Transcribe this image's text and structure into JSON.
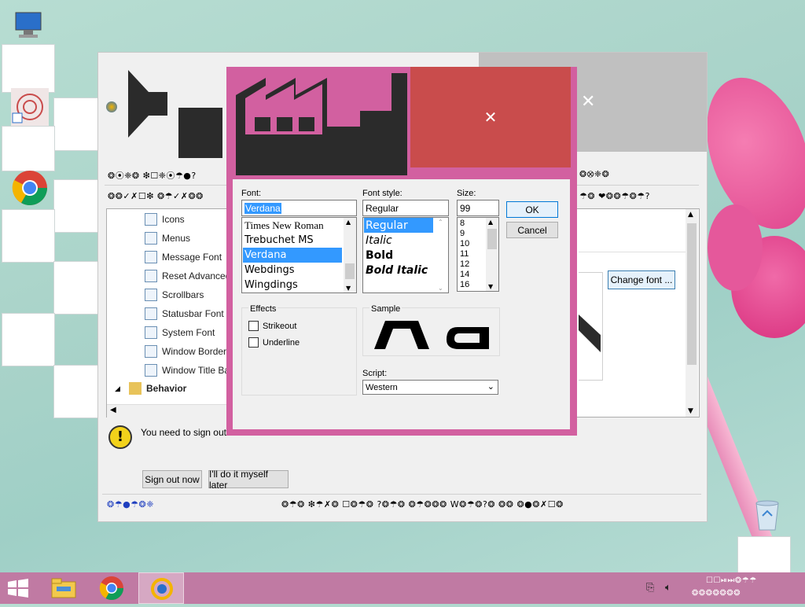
{
  "desktop": {
    "recycle_bin_label": ""
  },
  "bg_window": {
    "toolbar_row1_left": "❂⦿❈❂  ❇☐❈⦿☂●?",
    "toolbar_row1_right": "❂⭙❈❂",
    "toolbar_row2_left": "❂❂✓✗☐❇  ❂☂✓✗❂❂",
    "toolbar_row2_right": "☂❂  ❤❂❂☂❂☂?",
    "tree_items": [
      {
        "label": "Icons",
        "icon": "icons-icon"
      },
      {
        "label": "Menus",
        "icon": "menus-icon"
      },
      {
        "label": "Message Font",
        "icon": "warning-icon"
      },
      {
        "label": "Reset Advanced",
        "icon": "reset-icon"
      },
      {
        "label": "Scrollbars",
        "icon": "scrollbars-icon"
      },
      {
        "label": "Statusbar Font",
        "icon": "font-icon"
      },
      {
        "label": "System Font",
        "icon": "font-a-icon"
      },
      {
        "label": "Window Borders",
        "icon": "window-icon"
      },
      {
        "label": "Window Title Bars",
        "icon": "window-icon"
      }
    ],
    "behavior_label": "Behavior",
    "change_font_label": "Change font ...",
    "notice_text": "You need to sign out ar",
    "sign_out_label": "Sign out now",
    "do_it_later_label": "I'll do it myself later",
    "status_left": "❂☂●☂❂❈",
    "status_right": "❂☂❂  ❇☂✗❂  ☐❂☂❂  ?❂☂❂  ❂☂❂❂❂  W❂☂❂?❂  ❂❂  ❂●❂✗☐❂"
  },
  "font_dialog": {
    "font_label": "Font:",
    "font_value": "Verdana",
    "font_list": [
      "Times New Roman",
      "Trebuchet MS",
      "Verdana",
      "Webdings",
      "Wingdings"
    ],
    "font_selected_index": 2,
    "style_label": "Font style:",
    "style_value": "Regular",
    "style_list": [
      "Regular",
      "Italic",
      "Bold",
      "Bold Italic"
    ],
    "style_selected_index": 0,
    "size_label": "Size:",
    "size_value": "99",
    "size_list": [
      "8",
      "9",
      "10",
      "11",
      "12",
      "14",
      "16"
    ],
    "ok_label": "OK",
    "cancel_label": "Cancel",
    "effects_label": "Effects",
    "strikeout_label": "Strikeout",
    "underline_label": "Underline",
    "sample_label": "Sample",
    "script_label": "Script:",
    "script_value": "Western"
  },
  "taskbar": {
    "tray_text_top": "☐☐⏯⏭❂☂☂",
    "tray_text_bottom": "❂❂❂❂❂❂❂"
  },
  "colors": {
    "dialog_frame": "#d260a0",
    "close_red": "#c94c4c",
    "taskbar": "#c07aa3",
    "selection": "#3399ff"
  }
}
